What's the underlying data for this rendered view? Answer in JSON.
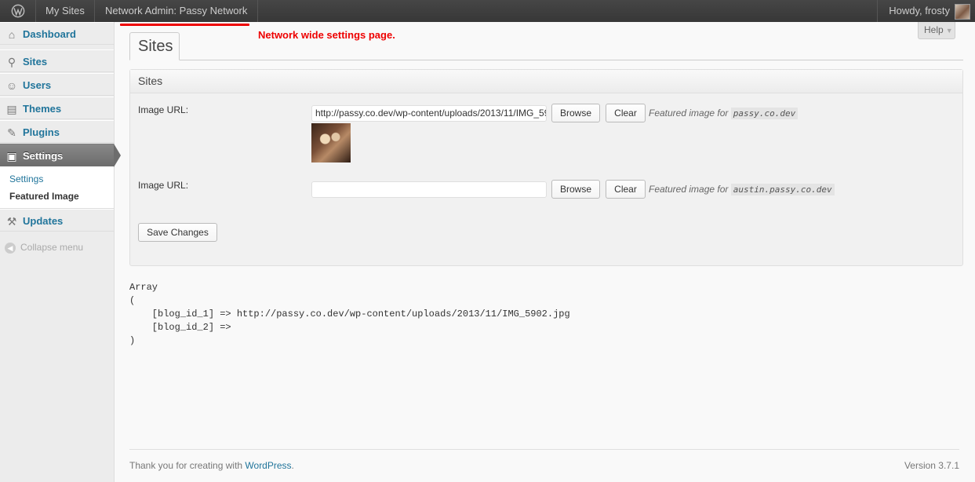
{
  "admin_bar": {
    "my_sites": "My Sites",
    "network_name": "Network Admin: Passy Network",
    "howdy": "Howdy, frosty"
  },
  "annotation": {
    "text": "Network wide settings page.",
    "color": "#e00000"
  },
  "sidebar": {
    "items": [
      {
        "label": "Dashboard",
        "icon": "home-icon"
      },
      {
        "label": "Sites",
        "icon": "sites-icon"
      },
      {
        "label": "Users",
        "icon": "users-icon"
      },
      {
        "label": "Themes",
        "icon": "themes-icon"
      },
      {
        "label": "Plugins",
        "icon": "plugins-icon"
      },
      {
        "label": "Settings",
        "icon": "settings-icon",
        "current": true
      },
      {
        "label": "Updates",
        "icon": "updates-icon"
      }
    ],
    "submenu": [
      "Settings",
      "Featured Image"
    ],
    "collapse": "Collapse menu"
  },
  "help": "Help",
  "tab": "Sites",
  "section": {
    "title": "Sites",
    "rows": [
      {
        "label": "Image URL:",
        "value": "http://passy.co.dev/wp-content/uploads/2013/11/IMG_5902.jpg",
        "browse": "Browse",
        "clear": "Clear",
        "note": "Featured image for",
        "site": "passy.co.dev"
      },
      {
        "label": "Image URL:",
        "value": "",
        "browse": "Browse",
        "clear": "Clear",
        "note": "Featured image for",
        "site": "austin.passy.co.dev"
      }
    ],
    "save": "Save Changes"
  },
  "debug": "Array\n(\n    [blog_id_1] => http://passy.co.dev/wp-content/uploads/2013/11/IMG_5902.jpg\n    [blog_id_2] => \n)",
  "footer": {
    "thanks": "Thank you for creating with ",
    "link": "WordPress",
    "period": ".",
    "version": "Version 3.7.1"
  },
  "colors": {
    "link": "#21759b",
    "adminbar": "#464646",
    "current_menu": "#777777"
  }
}
